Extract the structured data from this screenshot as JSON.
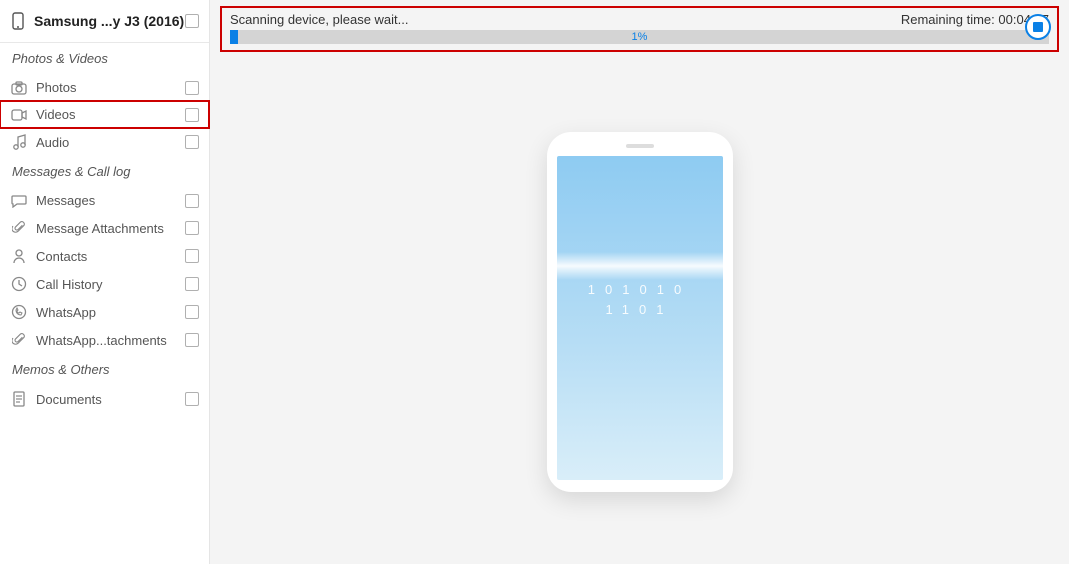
{
  "device": {
    "name": "Samsung ...y J3 (2016)"
  },
  "sections": [
    {
      "title": "Photos & Videos",
      "items": [
        {
          "label": "Photos",
          "icon": "camera-icon",
          "highlighted": false
        },
        {
          "label": "Videos",
          "icon": "video-icon",
          "highlighted": true
        },
        {
          "label": "Audio",
          "icon": "audio-icon",
          "highlighted": false
        }
      ]
    },
    {
      "title": "Messages & Call log",
      "items": [
        {
          "label": "Messages",
          "icon": "message-icon",
          "highlighted": false
        },
        {
          "label": "Message Attachments",
          "icon": "attachment-icon",
          "highlighted": false
        },
        {
          "label": "Contacts",
          "icon": "contacts-icon",
          "highlighted": false
        },
        {
          "label": "Call History",
          "icon": "callhistory-icon",
          "highlighted": false
        },
        {
          "label": "WhatsApp",
          "icon": "whatsapp-icon",
          "highlighted": false
        },
        {
          "label": "WhatsApp...tachments",
          "icon": "attachment-icon",
          "highlighted": false
        }
      ]
    },
    {
      "title": "Memos & Others",
      "items": [
        {
          "label": "Documents",
          "icon": "document-icon",
          "highlighted": false
        }
      ]
    }
  ],
  "scan": {
    "status": "Scanning device, please wait...",
    "remaining_label": "Remaining time:",
    "remaining_value": "00:04:27",
    "percent": 1,
    "percent_label": "1%"
  },
  "phone": {
    "binary_row1": "101010",
    "binary_row2": "1101"
  }
}
